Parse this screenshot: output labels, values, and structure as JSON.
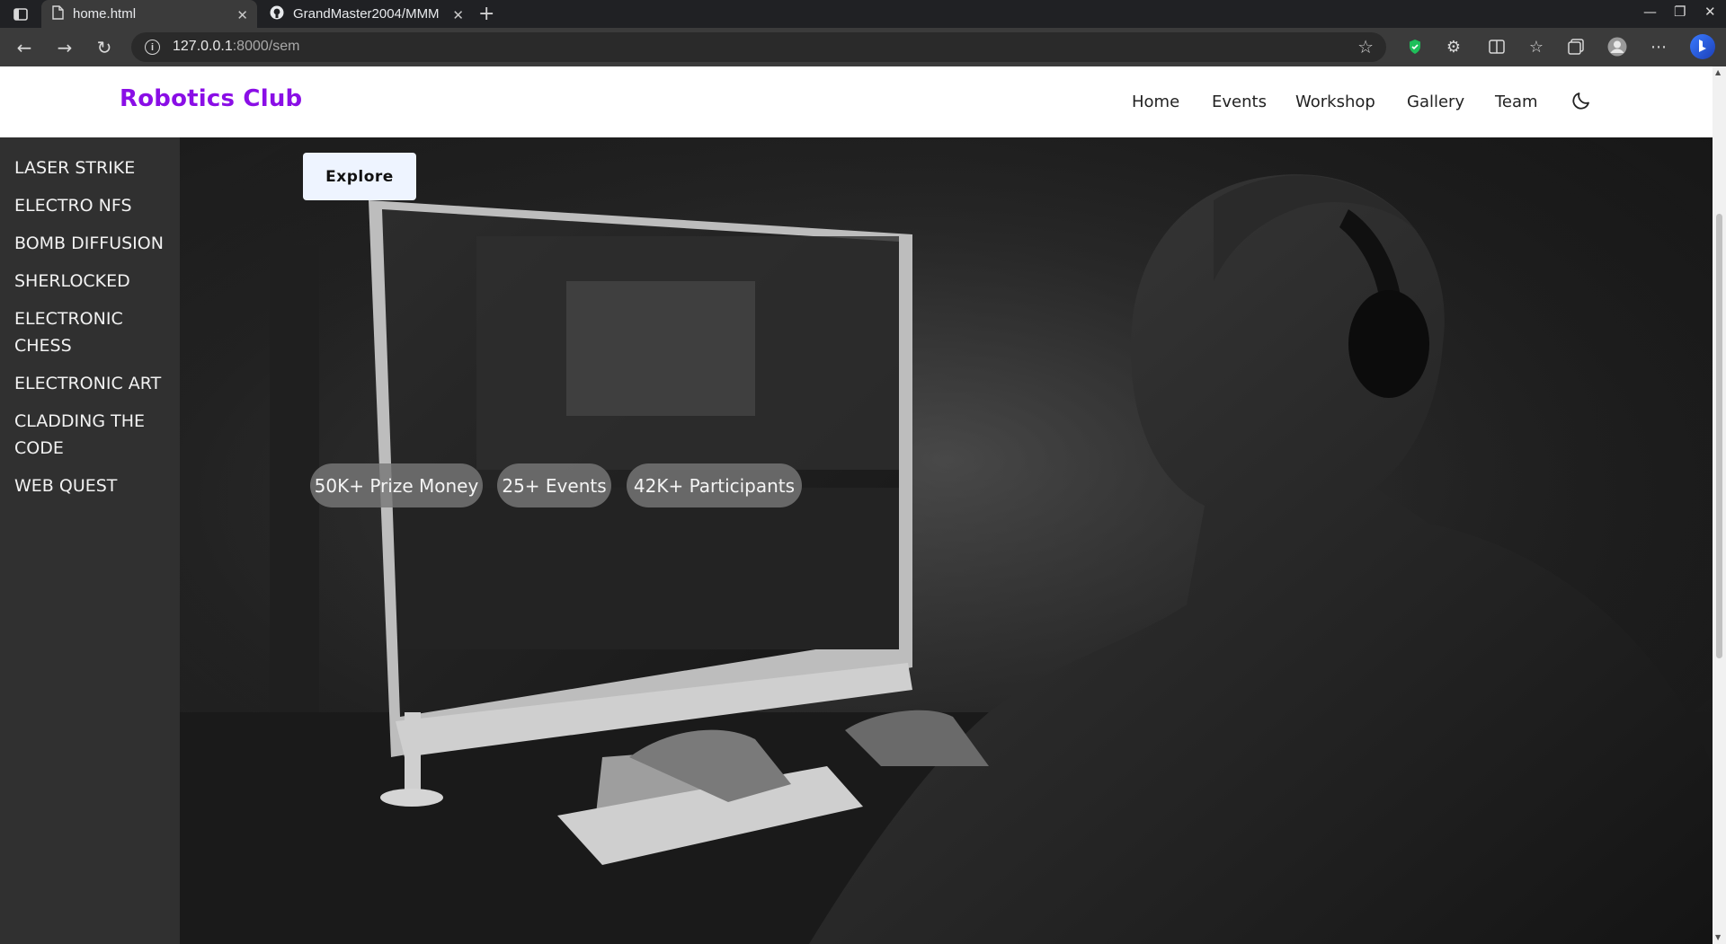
{
  "browser": {
    "tabs": [
      {
        "title": "home.html",
        "active": true
      },
      {
        "title": "GrandMaster2004/MMM",
        "active": false
      }
    ],
    "address": {
      "host": "127.0.0.1",
      "rest": ":8000/sem"
    }
  },
  "site": {
    "brand": "Robotics Club",
    "brand_color": "#8a0ee6",
    "nav": [
      "Home",
      "Events",
      "Workshop",
      "Gallery",
      "Team"
    ],
    "theme_icon": "moon-icon"
  },
  "sidebar": {
    "items": [
      "LASER STRIKE",
      "ELECTRO NFS",
      "BOMB DIFFUSION",
      "SHERLOCKED",
      "ELECTRONIC CHESS",
      "ELECTRONIC ART",
      "CLADDING THE CODE",
      "WEB QUEST"
    ]
  },
  "hero": {
    "explore_label": "Explore",
    "stats": [
      "50K+ Prize Money",
      "25+ Events",
      "42K+ Participants"
    ]
  }
}
